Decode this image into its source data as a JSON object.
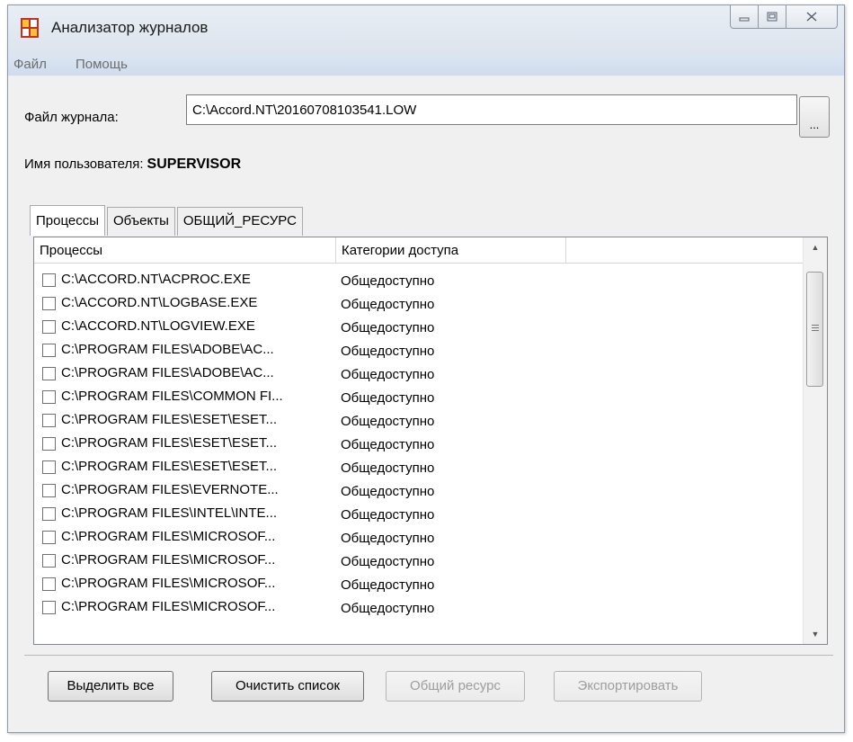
{
  "window": {
    "title": "Анализатор журналов",
    "icon": "app-icon"
  },
  "menu": {
    "items": [
      "Файл",
      "Помощь"
    ]
  },
  "form": {
    "file_label": "Файл журнала:",
    "file_value": "C:\\Accord.NT\\20160708103541.LOW",
    "browse_label": "...",
    "user_label": "Имя пользователя:",
    "user_value": "SUPERVISOR"
  },
  "tabs": [
    "Процессы",
    "Объекты",
    "ОБЩИЙ_РЕСУРС"
  ],
  "table": {
    "columns": [
      "Процессы",
      "Категории доступа",
      ""
    ],
    "rows": [
      {
        "path": "C:\\ACCORD.NT\\ACPROC.EXE",
        "category": "Общедоступно"
      },
      {
        "path": "C:\\ACCORD.NT\\LOGBASE.EXE",
        "category": "Общедоступно"
      },
      {
        "path": "C:\\ACCORD.NT\\LOGVIEW.EXE",
        "category": "Общедоступно"
      },
      {
        "path": "C:\\PROGRAM FILES\\ADOBE\\AC...",
        "category": "Общедоступно"
      },
      {
        "path": "C:\\PROGRAM FILES\\ADOBE\\AC...",
        "category": "Общедоступно"
      },
      {
        "path": "C:\\PROGRAM FILES\\COMMON FI...",
        "category": "Общедоступно"
      },
      {
        "path": "C:\\PROGRAM FILES\\ESET\\ESET...",
        "category": "Общедоступно"
      },
      {
        "path": "C:\\PROGRAM FILES\\ESET\\ESET...",
        "category": "Общедоступно"
      },
      {
        "path": "C:\\PROGRAM FILES\\ESET\\ESET...",
        "category": "Общедоступно"
      },
      {
        "path": "C:\\PROGRAM FILES\\EVERNOTE...",
        "category": "Общедоступно"
      },
      {
        "path": "C:\\PROGRAM FILES\\INTEL\\INTE...",
        "category": "Общедоступно"
      },
      {
        "path": "C:\\PROGRAM FILES\\MICROSOF...",
        "category": "Общедоступно"
      },
      {
        "path": "C:\\PROGRAM FILES\\MICROSOF...",
        "category": "Общедоступно"
      },
      {
        "path": "C:\\PROGRAM FILES\\MICROSOF...",
        "category": "Общедоступно"
      },
      {
        "path": "C:\\PROGRAM FILES\\MICROSOF...",
        "category": "Общедоступно"
      }
    ]
  },
  "buttons": {
    "select_all": "Выделить все",
    "clear_list": "Очистить список",
    "shared_resource": "Общий ресурс",
    "export": "Экспортировать"
  },
  "colors": {
    "menubar": "#d4e0ef",
    "disabled_text": "#9d9d9d"
  }
}
